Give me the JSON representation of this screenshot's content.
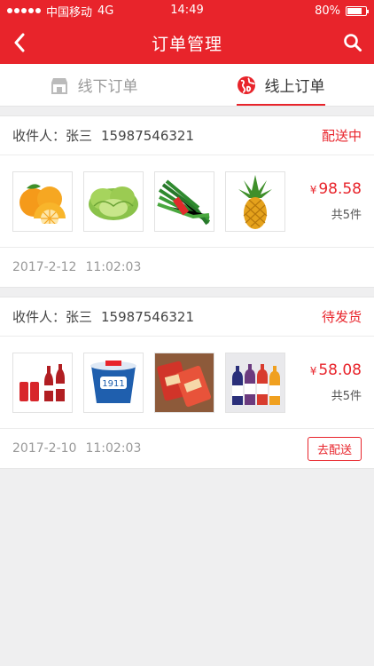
{
  "status_bar": {
    "carrier": "中国移动",
    "network": "4G",
    "time": "14:49",
    "battery": "80%",
    "battery_level": 0.8
  },
  "nav": {
    "title": "订单管理"
  },
  "tabs": [
    {
      "label": "线下订单",
      "icon": "store-icon",
      "active": false
    },
    {
      "label": "线上订单",
      "icon": "globe-icon",
      "active": true
    }
  ],
  "orders": [
    {
      "recipient_label": "收件人：张三",
      "phone": "15987546321",
      "status": "配送中",
      "items": [
        "orange",
        "lettuce",
        "chives",
        "pineapple"
      ],
      "price_symbol": "¥",
      "price": "98.58",
      "count": "共5件",
      "date": "2017-2-12",
      "time": "11:02:03"
    },
    {
      "recipient_label": "收件人：张三",
      "phone": "15987546321",
      "status": "待发货",
      "items": [
        "cola-bottles",
        "yogurt-cup",
        "snack-bags",
        "juice-bottles"
      ],
      "price_symbol": "¥",
      "price": "58.08",
      "count": "共5件",
      "date": "2017-2-10",
      "time": "11:02:03",
      "action": "去配送"
    }
  ],
  "colors": {
    "brand": "#e8242b"
  }
}
